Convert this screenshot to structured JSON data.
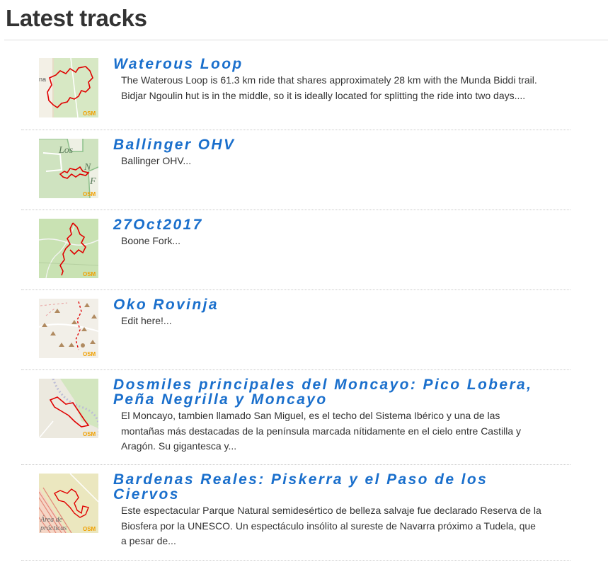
{
  "page": {
    "title": "Latest tracks"
  },
  "colors": {
    "title_link": "#1a6fcc",
    "text": "#333333",
    "track_line": "#e00000",
    "osm_badge": "#f0a000"
  },
  "tracks": [
    {
      "title": "Waterous Loop",
      "description": "The Waterous Loop is 61.3 km ride that shares approximately 28 km with the Munda Biddi trail. Bidjar Ngoulin hut is in the middle, so it is ideally located for splitting the ride into two days....",
      "thumb_badge": "OSM",
      "map_label": "na"
    },
    {
      "title": "Ballinger OHV",
      "description": "Ballinger OHV...",
      "thumb_badge": "OSM",
      "map_label": "Los"
    },
    {
      "title": "27Oct2017",
      "description": "Boone Fork...",
      "thumb_badge": "OSM",
      "map_label": ""
    },
    {
      "title": "Oko Rovinja",
      "description": "Edit here!...",
      "thumb_badge": "OSM",
      "map_label": ""
    },
    {
      "title": "Dosmiles principales del Moncayo: Pico Lobera, Peña Negrilla y Moncayo",
      "description": "El Moncayo, tambien llamado San Miguel, es el techo del Sistema Ibérico y una de las montañas más destacadas de la península marcada nítidamente en el cielo entre Castilla y Aragón. Su gigantesca y...",
      "thumb_badge": "OSM",
      "map_label": ""
    },
    {
      "title": "Bardenas Reales: Piskerra y el Paso de los Ciervos",
      "description": "Este espectacular Parque Natural semidesértico de belleza salvaje fue declarado Reserva de la Biosfera por la UNESCO. Un espectáculo insólito al sureste de Navarra próximo a Tudela, que a pesar de...",
      "thumb_badge": "OSM",
      "map_label": "Área de prácticas"
    }
  ]
}
